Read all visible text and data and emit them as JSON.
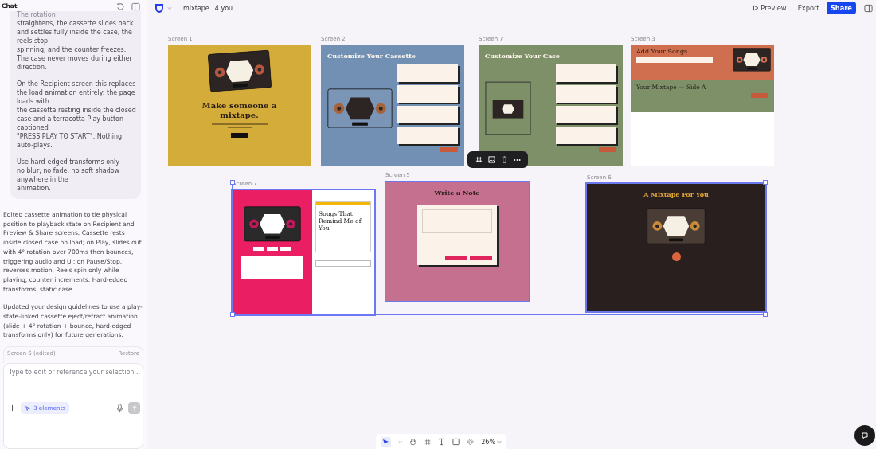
{
  "sidebar": {
    "title": "Chat",
    "bubble": {
      "faded_line": "The rotation",
      "paragraphs": [
        "straightens, the cassette slides back and settles fully inside the case, the reels stop\nspinning, and the counter freezes. The case never moves during either direction.",
        "On the Recipient screen this replaces the load animation entirely: the page loads with\nthe cassette resting inside the closed case and a terracotta Play button captioned\n\"PRESS PLAY TO START\". Nothing auto-plays.",
        "Use hard-edged transforms only — no blur, no fade, no soft shadow anywhere in the\nanimation."
      ]
    },
    "response": [
      "Edited cassette animation to tie physical position to playback state on Recipient and Preview & Share screens. Cassette rests inside closed case on load; on Play, slides out with 4° rotation over 700ms then bounces, triggering audio and UI; on Pause/Stop, reverses motion. Reels spin only while playing, counter increments. Hard-edged transforms, static case.",
      "Updated your design guidelines to use a play-state-linked cassette eject/retract animation (slide + 4° rotation + bounce, hard-edged transforms only) for future generations."
    ],
    "version": {
      "label": "Screen 6 (edited)",
      "action": "Restore"
    },
    "input": {
      "placeholder": "Type to edit or reference your selection...",
      "selection_chip": "3 elements"
    }
  },
  "topbar": {
    "project": "mixtape",
    "owner": "4 you",
    "buttons": [
      {
        "label": "Preview",
        "kind": "preview"
      },
      {
        "label": "Export",
        "kind": "plain"
      },
      {
        "label": "Share",
        "kind": "primary"
      }
    ]
  },
  "frames": [
    {
      "label": "Screen 1",
      "kind": "intro",
      "selected": false,
      "heading": "Make someone a mixtape."
    },
    {
      "label": "Screen 2",
      "kind": "cassette",
      "selected": false,
      "heading": "Customize Your Cassette"
    },
    {
      "label": "Screen 7",
      "kind": "case",
      "selected": false,
      "heading": "Customize Your Case"
    },
    {
      "label": "Screen 3",
      "kind": "songs",
      "selected": false,
      "heading": "Add Your Songs",
      "subheading": "Your Mixtape — Side A"
    },
    {
      "label": "Screen 7",
      "kind": "player",
      "selected": true,
      "heading": "Songs That Remind Me of You"
    },
    {
      "label": "Screen 5",
      "kind": "note",
      "selected": true,
      "heading": "Write a Note"
    },
    {
      "label": "Screen 6",
      "kind": "recipient",
      "selected": true,
      "heading": "A Mixtape For You"
    }
  ],
  "bottom_toolbar": {
    "zoom": "26%"
  }
}
